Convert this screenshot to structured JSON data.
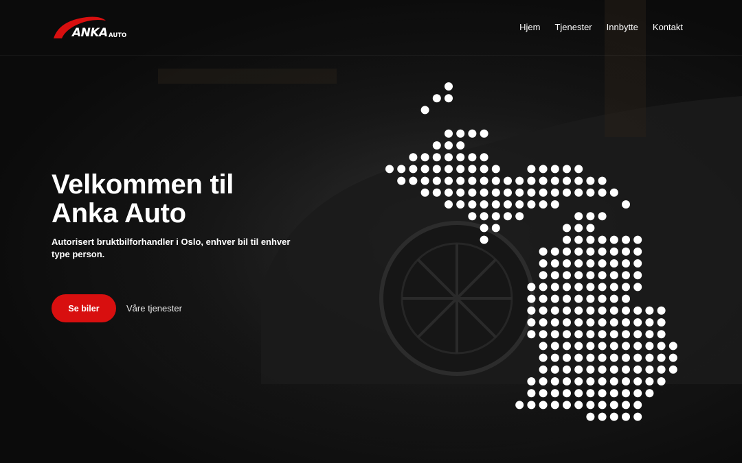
{
  "brand": {
    "logo_name": "ANKA",
    "logo_suffix": "AUTO",
    "accent_color": "#d80f0f"
  },
  "nav": {
    "items": [
      {
        "label": "Hjem"
      },
      {
        "label": "Tjenester"
      },
      {
        "label": "Innbytte"
      },
      {
        "label": "Kontakt"
      }
    ]
  },
  "hero": {
    "title_line1": "Velkommen til",
    "title_line2": "Anka Auto",
    "subtitle": "Autorisert bruktbilforhandler i Oslo, enhver bil til enhver type person.",
    "primary_button": "Se biler",
    "secondary_link": "Våre tjenester"
  },
  "map": {
    "icon": "dotted-map-graphic",
    "dot_color": "#ffffff"
  }
}
